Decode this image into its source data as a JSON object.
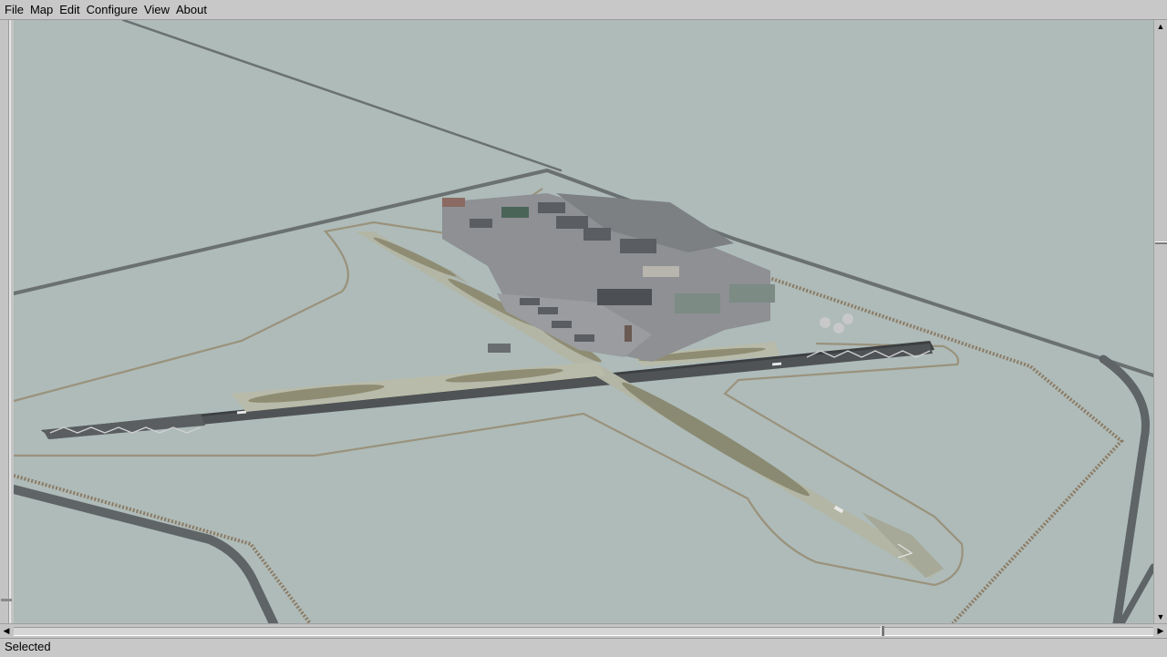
{
  "menu": {
    "items": [
      {
        "id": "file",
        "label": "File"
      },
      {
        "id": "map",
        "label": "Map"
      },
      {
        "id": "edit",
        "label": "Edit"
      },
      {
        "id": "configure",
        "label": "Configure"
      },
      {
        "id": "view",
        "label": "View"
      },
      {
        "id": "about",
        "label": "About"
      }
    ]
  },
  "status": {
    "text": "Selected"
  },
  "colors": {
    "terrain": "#aebbb9",
    "runway": "#4f5355",
    "taxiway": "#b3b6a4",
    "apron": "#8e9093",
    "road": "#6a6e70",
    "fence": "#8c7a62"
  },
  "icons": {
    "scroll_up": "arrow-up-icon",
    "scroll_down": "arrow-down-icon",
    "scroll_left": "arrow-left-icon",
    "scroll_right": "arrow-right-icon"
  }
}
